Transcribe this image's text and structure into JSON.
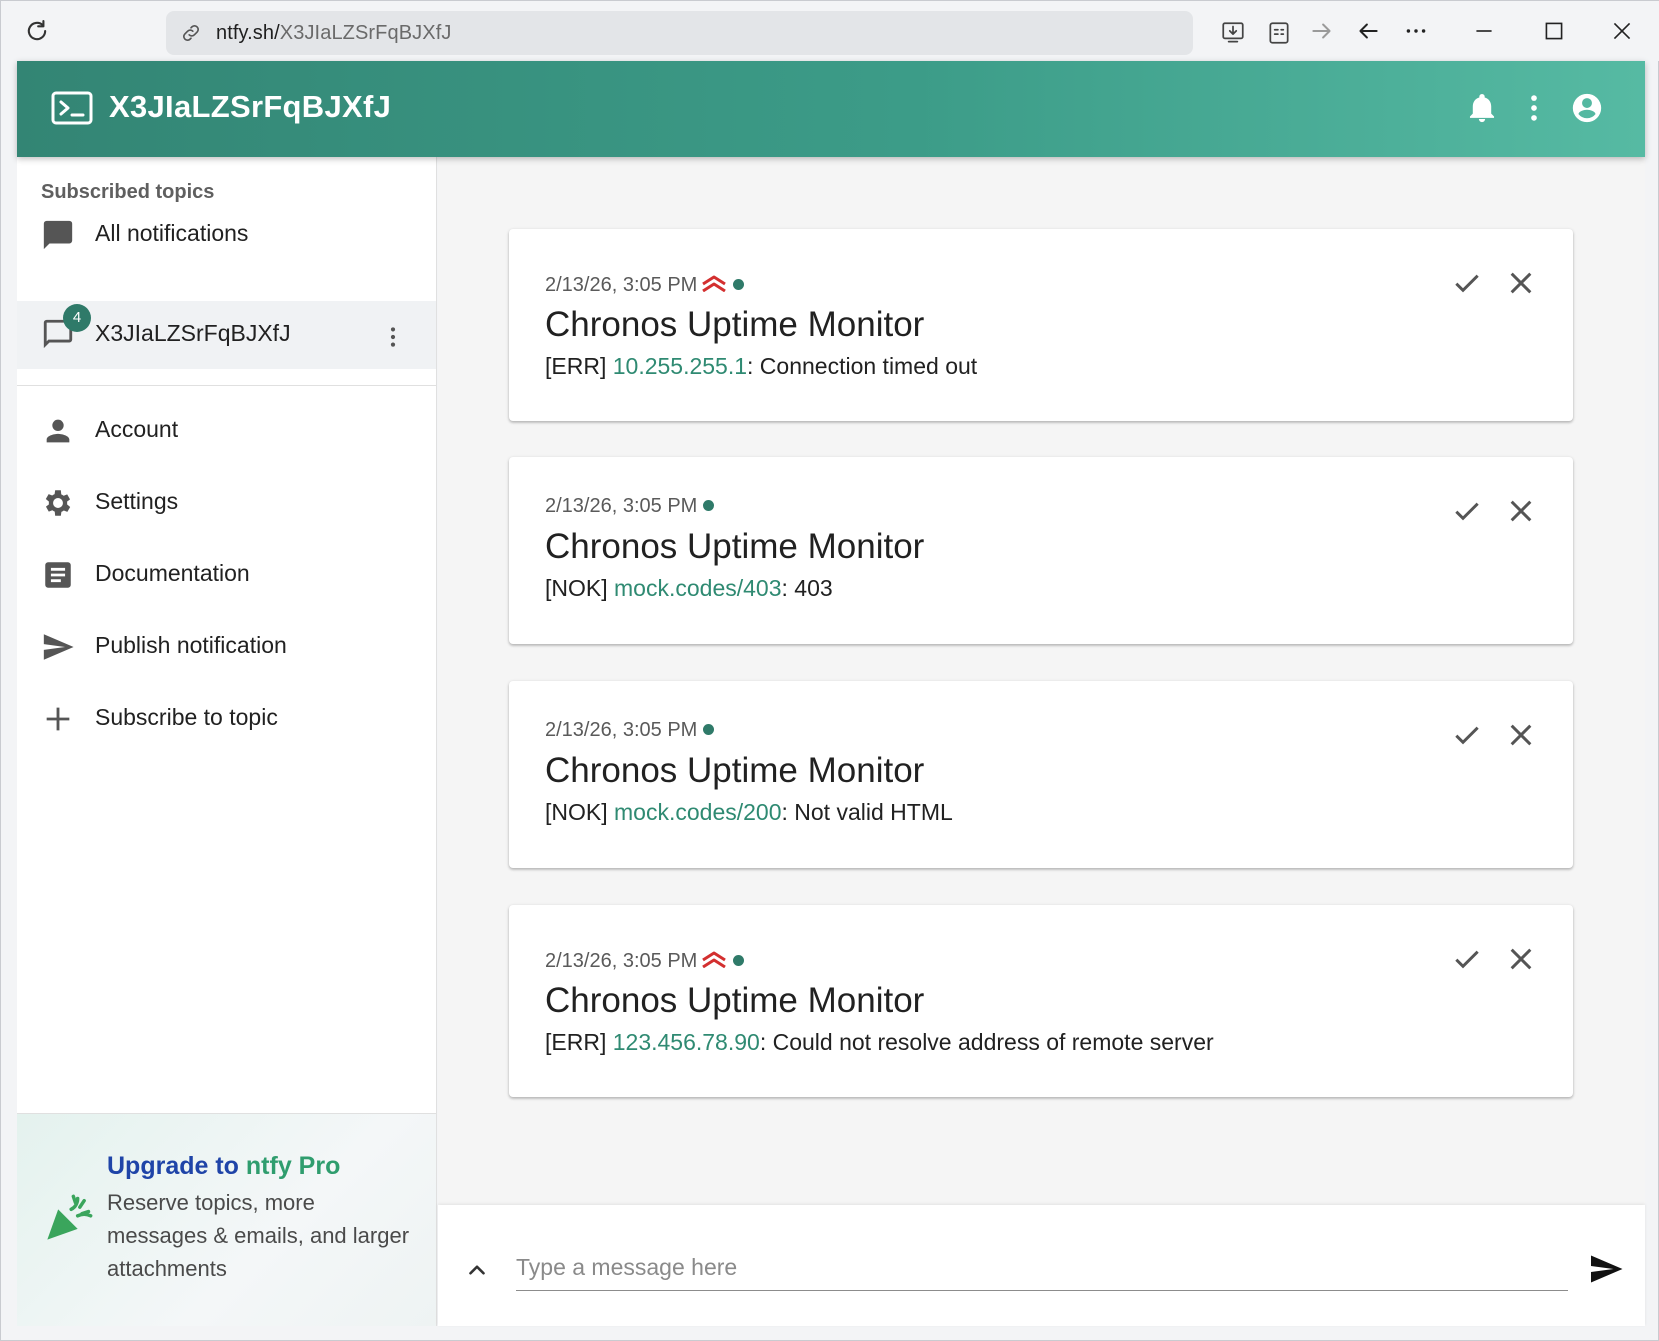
{
  "browser": {
    "url_host": "ntfy.sh/",
    "url_path": "X3JIaLZSrFqBJXfJ"
  },
  "appbar": {
    "title": "X3JIaLZSrFqBJXfJ"
  },
  "sidebar": {
    "section_label": "Subscribed topics",
    "all_notifications": "All notifications",
    "topic": {
      "label": "X3JIaLZSrFqBJXfJ",
      "badge": "4"
    },
    "items": [
      {
        "label": "Account",
        "icon": "person-icon"
      },
      {
        "label": "Settings",
        "icon": "gear-icon"
      },
      {
        "label": "Documentation",
        "icon": "document-icon"
      },
      {
        "label": "Publish notification",
        "icon": "send-icon"
      },
      {
        "label": "Subscribe to topic",
        "icon": "plus-icon"
      }
    ],
    "promo": {
      "title_part1": "Upgrade to ",
      "title_part2": "ntfy Pro",
      "text": "Reserve topics, more messages & emails, and larger attachments"
    }
  },
  "notifications": [
    {
      "time": "2/13/26, 3:05 PM",
      "high_priority": true,
      "title": "Chronos Uptime Monitor",
      "prefix": "[ERR] ",
      "link": "10.255.255.1",
      "suffix": ": Connection timed out"
    },
    {
      "time": "2/13/26, 3:05 PM",
      "high_priority": false,
      "title": "Chronos Uptime Monitor",
      "prefix": "[NOK] ",
      "link": "mock.codes/403",
      "suffix": ": 403"
    },
    {
      "time": "2/13/26, 3:05 PM",
      "high_priority": false,
      "title": "Chronos Uptime Monitor",
      "prefix": "[NOK] ",
      "link": "mock.codes/200",
      "suffix": ": Not valid HTML"
    },
    {
      "time": "2/13/26, 3:05 PM",
      "high_priority": true,
      "title": "Chronos Uptime Monitor",
      "prefix": "[ERR] ",
      "link": "123.456.78.90",
      "suffix": ": Could not resolve address of remote server"
    }
  ],
  "composer": {
    "placeholder": "Type a message here"
  },
  "colors": {
    "accent": "#338574",
    "link": "#2f8a72",
    "priority_high": "#d32f2f",
    "promo_title_blue": "#1f44a8",
    "promo_title_green": "#2f9d6e"
  }
}
